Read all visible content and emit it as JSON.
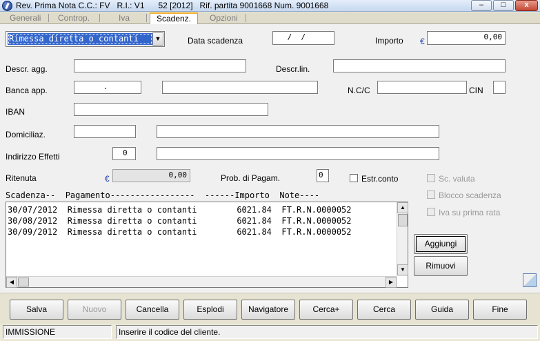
{
  "window": {
    "title": "Rev. Prima Nota C.C.: FV   R.I.: V1      52 [2012]   Rif. partita 9001668 Num. 9001668",
    "minimize_glyph": "–",
    "maximize_glyph": "□",
    "close_glyph": "x"
  },
  "tabs": [
    {
      "label": "Generali"
    },
    {
      "label": "Controp."
    },
    {
      "label": "Iva"
    },
    {
      "label": "Scadenz."
    },
    {
      "label": "Opzioni"
    }
  ],
  "active_tab": "Scadenz.",
  "form": {
    "payment_type": "Rimessa diretta o contanti",
    "data_scadenza_label": "Data scadenza",
    "data_scadenza_value": " /  / ",
    "importo_label": "Importo",
    "currency_symbol": "€",
    "importo_value": "0,00",
    "descr_agg_label": "Descr. agg.",
    "descr_agg_value": "",
    "descr_lin_label": "Descr.lin.",
    "descr_lin_value": "",
    "banca_app_label": "Banca app.",
    "banca_code_value": ".",
    "banca_name_value": "",
    "ncc_label": "N.C/C",
    "ncc_value": "",
    "cin_label": "CIN",
    "cin_value": "",
    "iban_label": "IBAN",
    "iban_value": "",
    "domiciliaz_label": "Domiciliaz.",
    "domiciliaz_code_value": "",
    "domiciliaz_desc_value": "",
    "indirizzo_label": "Indirizzo Effetti",
    "indirizzo_code_value": "0",
    "indirizzo_desc_value": "",
    "ritenuta_label": "Ritenuta",
    "ritenuta_value": "0,00",
    "prob_label": "Prob. di Pagam.",
    "prob_value": "0",
    "estr_conto_label": "Estr.conto",
    "sc_valuta_label": "Sc. valuta",
    "blocco_label": "Blocco scadenza",
    "iva_prima_label": "Iva su prima rata"
  },
  "list": {
    "header": "Scadenza--  Pagamento-----------------  ------Importo  Note----",
    "rows": [
      "30/07/2012  Rimessa diretta o contanti        6021.84  FT.R.N.0000052",
      "30/08/2012  Rimessa diretta o contanti        6021.84  FT.R.N.0000052",
      "30/09/2012  Rimessa diretta o contanti        6021.84  FT.R.N.0000052"
    ]
  },
  "side_buttons": {
    "aggiungi": "Aggiungi",
    "rimuovi": "Rimuovi"
  },
  "buttons": {
    "salva": "Salva",
    "nuovo": "Nuovo",
    "cancella": "Cancella",
    "esplodi": "Esplodi",
    "navigatore": "Navigatore",
    "cerca_plus": "Cerca+",
    "cerca": "Cerca",
    "guida": "Guida",
    "fine": "Fine"
  },
  "status": {
    "mode": "IMMISSIONE",
    "message": "Inserire il codice del cliente."
  }
}
